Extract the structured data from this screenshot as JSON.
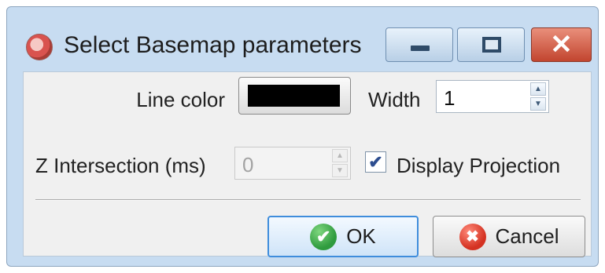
{
  "window": {
    "title": "Select Basemap parameters",
    "icon": "basemap-app-icon",
    "controls": {
      "minimize_icon": "minimize-icon",
      "maximize_icon": "maximize-icon",
      "close_glyph": "✕"
    }
  },
  "form": {
    "line_color_label": "Line color",
    "line_color_value": "#000000",
    "width_label": "Width",
    "width_value": "1",
    "z_intersection_label": "Z Intersection (ms)",
    "z_intersection_value": "0",
    "z_intersection_enabled": false,
    "display_projection_label": "Display Projection",
    "display_projection_checked": true,
    "check_glyph": "✔",
    "spin_up_glyph": "▲",
    "spin_down_glyph": "▼"
  },
  "buttons": {
    "ok_label": "OK",
    "ok_glyph": "✔",
    "cancel_label": "Cancel",
    "cancel_glyph": "✖"
  }
}
